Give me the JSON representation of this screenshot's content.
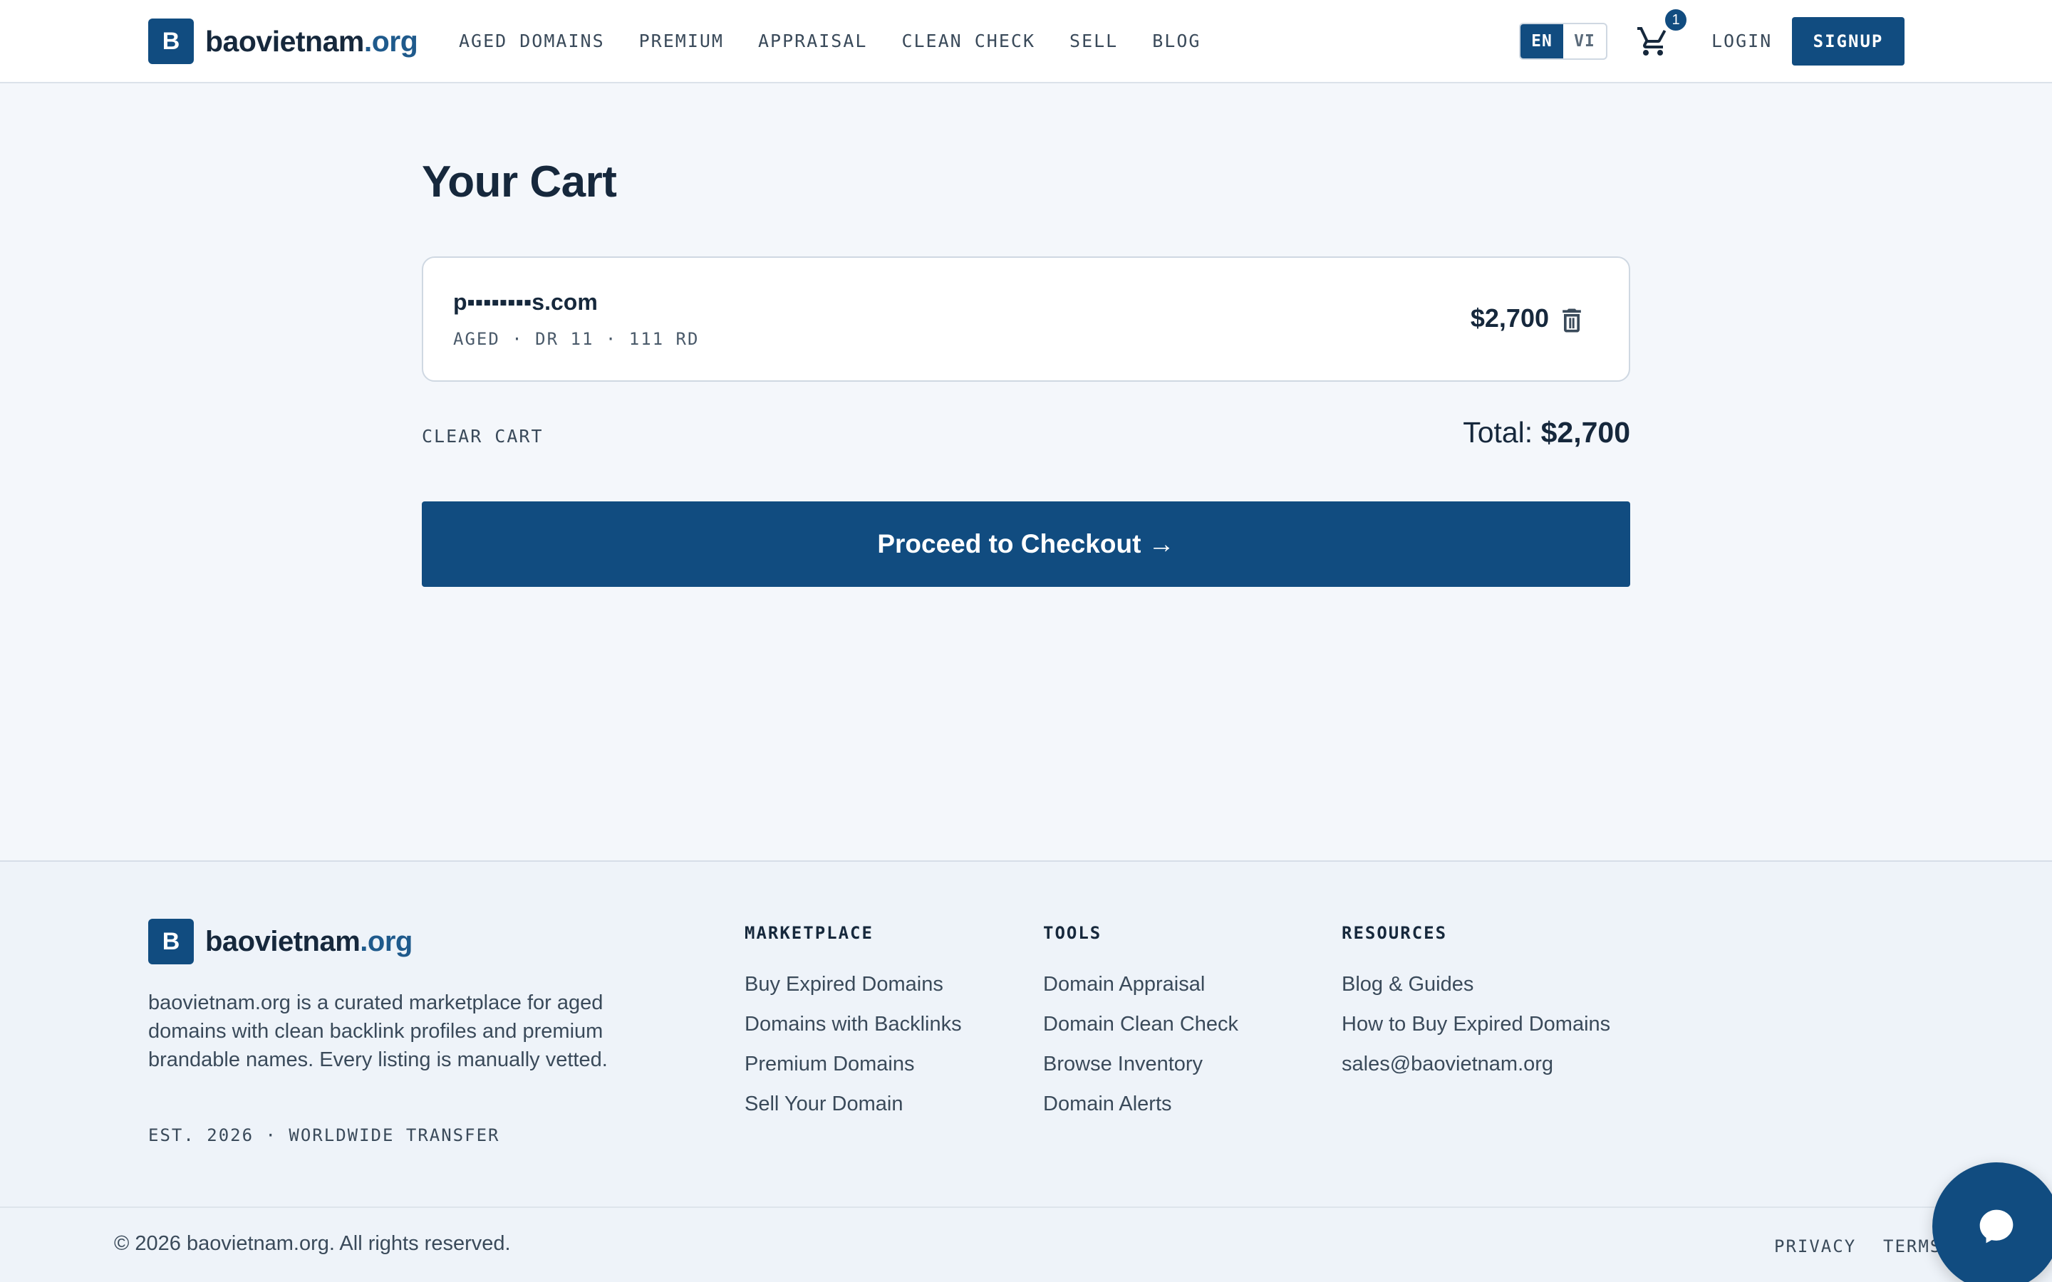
{
  "brand": {
    "name": "baovietnam",
    "tld": ".org",
    "mark": "B"
  },
  "nav": {
    "items": [
      "AGED DOMAINS",
      "PREMIUM",
      "APPRAISAL",
      "CLEAN CHECK",
      "SELL",
      "BLOG"
    ]
  },
  "header": {
    "lang_en": "EN",
    "lang_vi": "VI",
    "cart_count": "1",
    "login": "LOGIN",
    "signup": "SIGNUP"
  },
  "cart": {
    "title": "Your Cart",
    "item": {
      "name": "p▪▪▪▪▪▪▪▪s.com",
      "meta": "AGED · DR 11 · 111 RD",
      "price": "$2,700"
    },
    "clear_label": "CLEAR CART",
    "total_label": "Total:",
    "total_value": "$2,700",
    "checkout_label": "Proceed to Checkout →"
  },
  "footer": {
    "description": "baovietnam.org is a curated marketplace for aged domains with clean backlink profiles and premium brandable names. Every listing is manually vetted.",
    "est": "EST. 2026 · WORLDWIDE TRANSFER",
    "columns": [
      {
        "heading": "MARKETPLACE",
        "links": [
          "Buy Expired Domains",
          "Domains with Backlinks",
          "Premium Domains",
          "Sell Your Domain"
        ]
      },
      {
        "heading": "TOOLS",
        "links": [
          "Domain Appraisal",
          "Domain Clean Check",
          "Browse Inventory",
          "Domain Alerts"
        ]
      },
      {
        "heading": "RESOURCES",
        "links": [
          "Blog & Guides",
          "How to Buy Expired Domains",
          "sales@baovietnam.org"
        ]
      }
    ],
    "copyright": "© 2026 baovietnam.org. All rights reserved.",
    "privacy": "PRIVACY",
    "terms": "TERMS"
  },
  "colors": {
    "primary": "#114c80",
    "background": "#f4f7fb",
    "text": "#16283c"
  },
  "icons": [
    "cart-icon",
    "trash-icon",
    "chat-icon"
  ]
}
